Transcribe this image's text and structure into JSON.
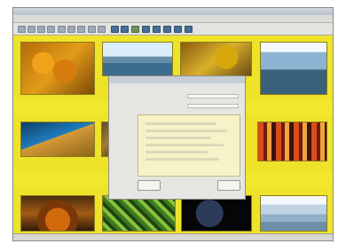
{
  "window": {
    "title": ""
  },
  "menu": {
    "items": [
      "",
      "",
      "",
      "",
      "",
      "",
      ""
    ]
  },
  "status": {
    "text": ""
  },
  "dialog": {
    "title": "",
    "label_1": "",
    "label_2": "",
    "label_3": "",
    "field_1": "",
    "field_2": "",
    "ok_label": "",
    "cancel_label": ""
  },
  "icons": [
    "window-icon",
    "folder-icon",
    "image-icon",
    "zoom-icon",
    "print-icon"
  ],
  "colors": {
    "accent": "#efe32a",
    "chrome": "#d4d0c8",
    "panel": "#f7f2c7"
  }
}
